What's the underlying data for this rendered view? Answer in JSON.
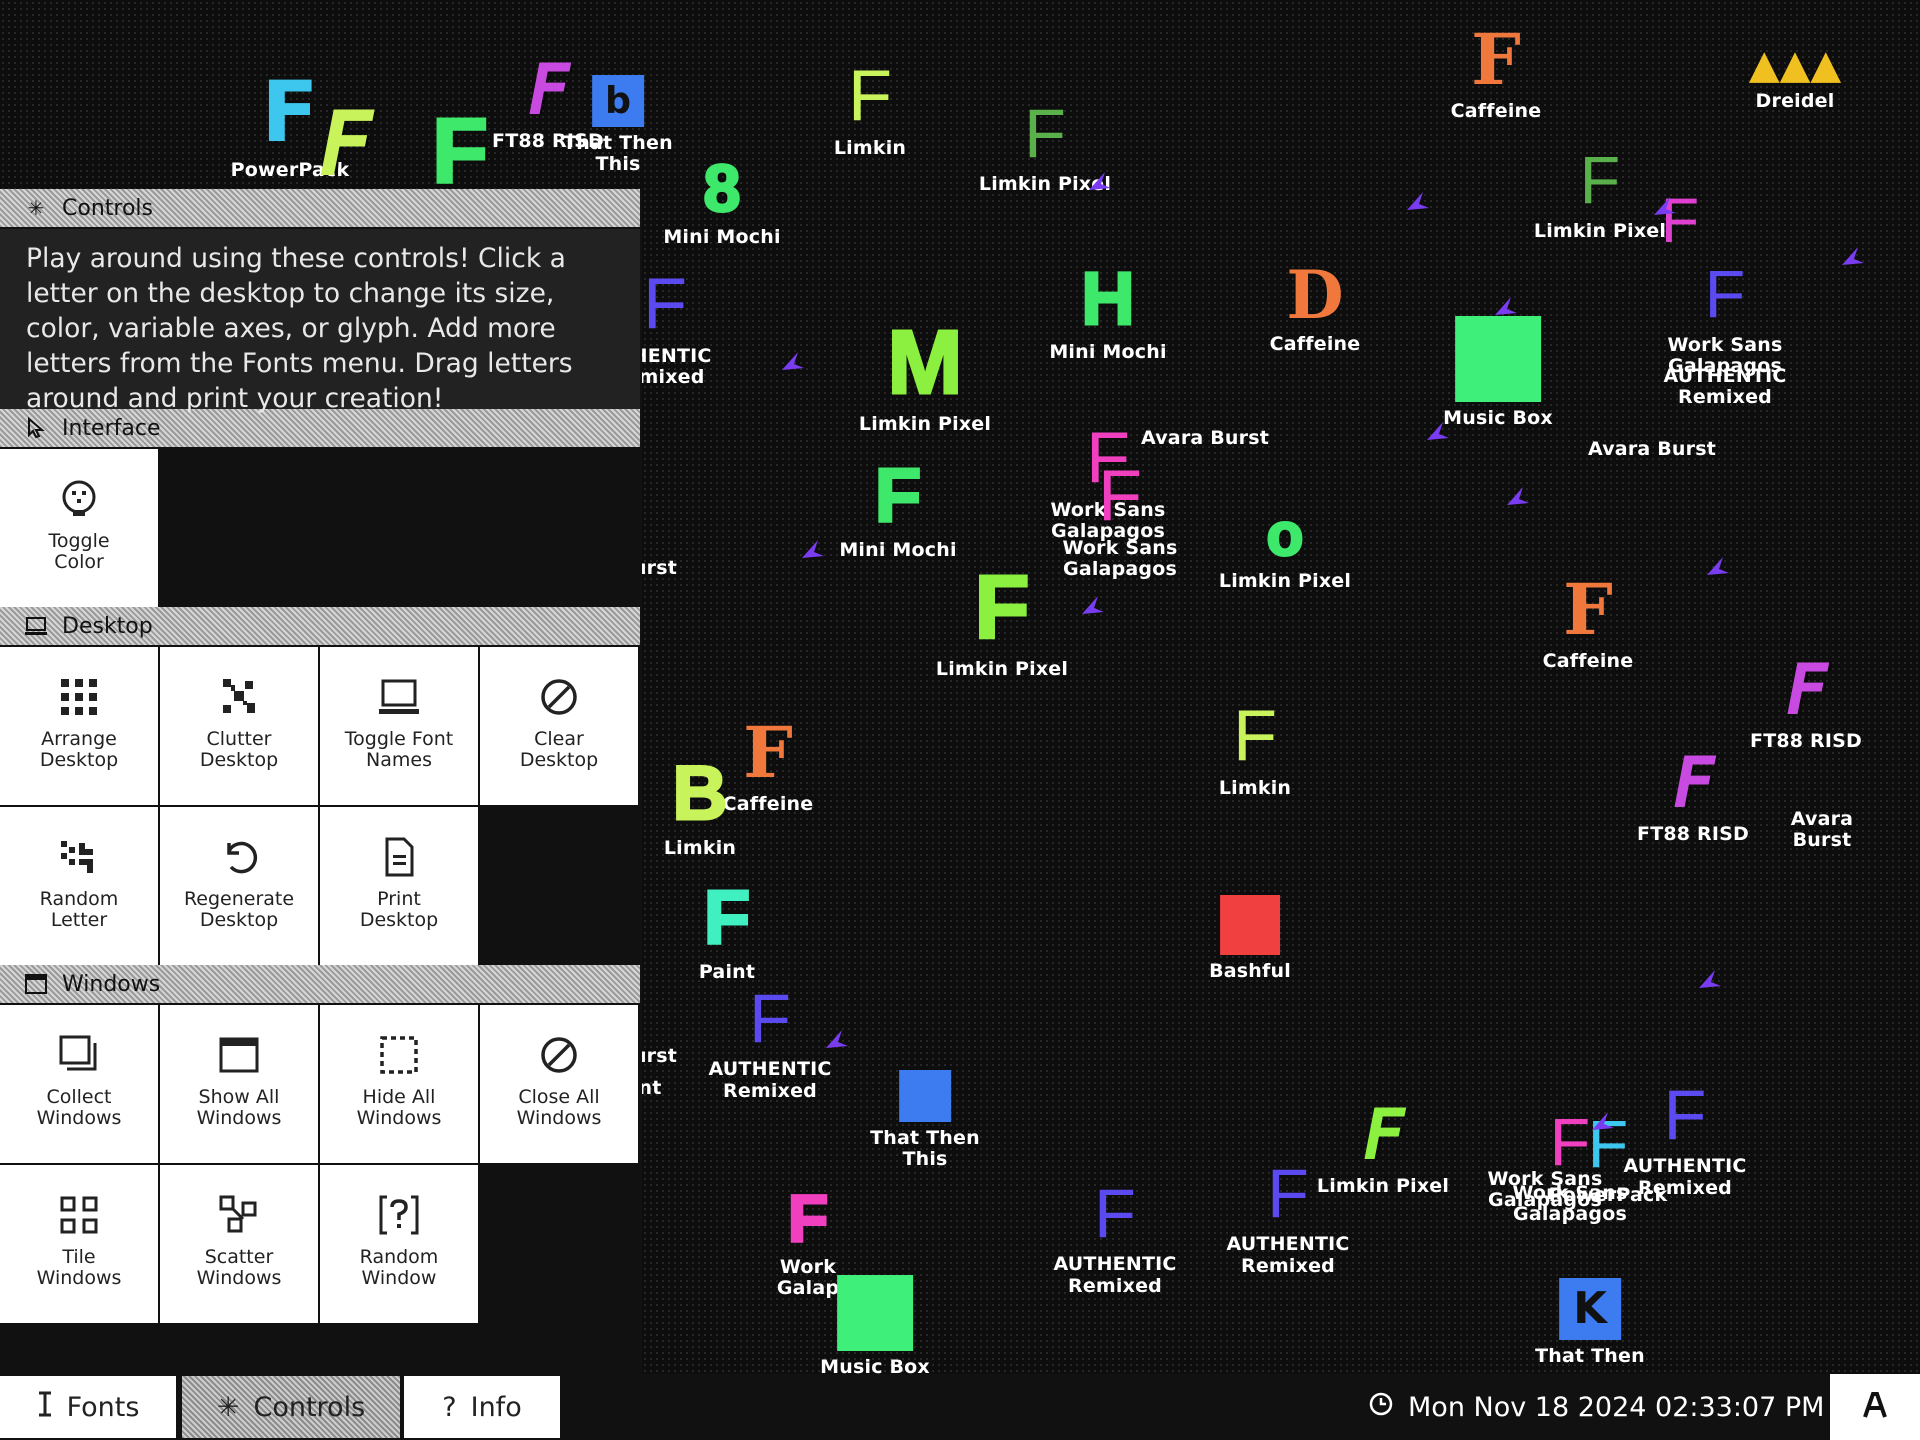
{
  "desktop_items": [
    {
      "glyph": "F",
      "font": "PowerPack",
      "color": "#3ec7ee",
      "label": "PowerPack"
    },
    {
      "glyph": "F",
      "font": "Limkin Pixel",
      "color": "#c8f35a",
      "label": ""
    },
    {
      "glyph": "F",
      "font": "Mini Mochi",
      "color": "#3ee86b",
      "label": ""
    },
    {
      "glyph": "F",
      "font": "FT88 RISD",
      "color": "#c84ae0",
      "label": "FT88 RISD"
    },
    {
      "glyph": "b",
      "font": "That Then This",
      "color": "#3d7bf0",
      "label": "That Then\nThis"
    },
    {
      "glyph": "8",
      "font": "Mini Mochi",
      "color": "#3ee86b",
      "label": "Mini Mochi"
    },
    {
      "glyph": "F",
      "font": "Limkin",
      "color": "#c8f35a",
      "label": "Limkin"
    },
    {
      "glyph": "F",
      "font": "Limkin Pixel",
      "color": "#5ab04a",
      "label": "Limkin Pixel"
    },
    {
      "glyph": "F",
      "font": "Caffeine",
      "color": "#f0783c",
      "label": "Caffeine"
    },
    {
      "glyph": "Dreidel",
      "font": "Dreidel",
      "color": "#f0c020",
      "label": "Dreidel"
    },
    {
      "glyph": "F",
      "font": "Limkin Pixel",
      "color": "#5ab04a",
      "label": "Limkin Pixel"
    },
    {
      "glyph": "F",
      "font": "Work Sans Galapagos",
      "color": "#e040d0",
      "label": ""
    },
    {
      "glyph": "F",
      "font": "AUTHENTIC Remixed",
      "color": "#5a4af0",
      "label": "Work Sans\nGalapagos"
    },
    {
      "glyph": "F",
      "font": "AUTHENTIC Remixed",
      "color": "#5a4af0",
      "label": "THENTIC\nemixed"
    },
    {
      "glyph": "M",
      "font": "Limkin Pixel",
      "color": "#8cf040",
      "label": "Limkin Pixel"
    },
    {
      "glyph": "H",
      "font": "Mini Mochi",
      "color": "#3ee86b",
      "label": "Mini Mochi"
    },
    {
      "glyph": "D",
      "font": "Caffeine",
      "color": "#f0783c",
      "label": "Caffeine"
    },
    {
      "glyph": "",
      "font": "Music Box",
      "color": "#3ef07a",
      "label": "Music Box"
    },
    {
      "glyph": "",
      "font": "AUTHENTIC Remixed",
      "color": "",
      "label": "AUTHENTIC\nRemixed"
    },
    {
      "glyph": "",
      "font": "Avara Burst",
      "color": "",
      "label": "Avara Burst"
    },
    {
      "glyph": "",
      "font": "Avara Burst",
      "color": "",
      "label": "Avara Burst"
    },
    {
      "glyph": "F",
      "font": "Work Sans Galapagos",
      "color": "#f040c0",
      "label": "Work Sans\nGalapagos"
    },
    {
      "glyph": "F",
      "font": "Work Sans Galapagos",
      "color": "#f040c0",
      "label": "Work Sans\nGalapagos"
    },
    {
      "glyph": "F",
      "font": "Mini Mochi",
      "color": "#3ee86b",
      "label": "Mini Mochi"
    },
    {
      "glyph": "o",
      "font": "Limkin Pixel",
      "color": "#3ee86b",
      "label": "Limkin Pixel"
    },
    {
      "glyph": "",
      "font": "Avara Burst",
      "color": "",
      "label": "urst"
    },
    {
      "glyph": "F",
      "font": "Limkin Pixel",
      "color": "#8cf040",
      "label": "Limkin Pixel"
    },
    {
      "glyph": "F",
      "font": "Caffeine",
      "color": "#f0783c",
      "label": "Caffeine"
    },
    {
      "glyph": "F",
      "font": "FT88 RISD",
      "color": "#c84ae0",
      "label": "FT88 RISD"
    },
    {
      "glyph": "",
      "font": "Avara Burst",
      "color": "",
      "label": "Avara Burst"
    },
    {
      "glyph": "F",
      "font": "FT88 RISD",
      "color": "#c84ae0",
      "label": "FT88 RISD"
    },
    {
      "glyph": "F",
      "font": "Caffeine",
      "color": "#f0783c",
      "label": "Caffeine"
    },
    {
      "glyph": "B",
      "font": "Limkin",
      "color": "#c8f35a",
      "label": "Limkin"
    },
    {
      "glyph": "F",
      "font": "Limkin",
      "color": "#c8f35a",
      "label": "Limkin"
    },
    {
      "glyph": "F",
      "font": "Paint",
      "color": "#40f0c0",
      "label": "Paint"
    },
    {
      "glyph": "",
      "font": "Bashful",
      "color": "#f04040",
      "label": "Bashful"
    },
    {
      "glyph": "F",
      "font": "AUTHENTIC Remixed",
      "color": "#5a4af0",
      "label": "AUTHENTIC\nRemixed"
    },
    {
      "glyph": "",
      "font": "Avara Burst",
      "color": "",
      "label": "urst"
    },
    {
      "glyph": "",
      "font": "Paint",
      "color": "",
      "label": "nt"
    },
    {
      "glyph": "",
      "font": "That Then This",
      "color": "#3d7bf0",
      "label": "That Then\nThis"
    },
    {
      "glyph": "F",
      "font": "Limkin Pixel",
      "color": "#8cf040",
      "label": "Limkin Pixel"
    },
    {
      "glyph": "F",
      "font": "Work Sans Galapagos",
      "color": "#f040c0",
      "label": "Work Sans\nGalapagos"
    },
    {
      "glyph": "F",
      "font": "PowerPack",
      "color": "#3ec7ee",
      "label": "PowerPack"
    },
    {
      "glyph": "F",
      "font": "AUTHENTIC Remixed",
      "color": "#5a4af0",
      "label": "AUTHENTIC\nRemixed"
    },
    {
      "glyph": "F",
      "font": "Work Sans Galapagos",
      "color": "#f040c0",
      "label": "Work Sans\nGalapagos"
    },
    {
      "glyph": "F",
      "font": "Work Sans Galapagos",
      "color": "#f040c0",
      "label": "Work\nGalap"
    },
    {
      "glyph": "",
      "font": "Music Box",
      "color": "#3ef07a",
      "label": "Music Box"
    },
    {
      "glyph": "F",
      "font": "AUTHENTIC Remixed",
      "color": "#5a4af0",
      "label": "AUTHENTIC\nRemixed"
    },
    {
      "glyph": "F",
      "font": "AUTHENTIC Remixed",
      "color": "#5a4af0",
      "label": "AUTHENTIC\nRemixed"
    },
    {
      "glyph": "K",
      "font": "That Then This",
      "color": "#3d7bf0",
      "label": "That Then"
    }
  ],
  "controls": {
    "title": "Controls",
    "title_icon": "sparkle-icon",
    "intro": "Play around using these controls! Click a letter on the desktop to change its size, color, variable axes, or glyph. Add more letters from the Fonts menu. Drag letters around and print your creation!",
    "interface": {
      "title": "Interface",
      "icon": "cursor-icon",
      "buttons": [
        {
          "label": "Toggle\nColor",
          "icon": "palette-icon"
        }
      ]
    },
    "desktop": {
      "title": "Desktop",
      "icon": "monitor-icon",
      "buttons": [
        {
          "label": "Arrange\nDesktop",
          "icon": "grid-icon"
        },
        {
          "label": "Clutter\nDesktop",
          "icon": "clutter-icon"
        },
        {
          "label": "Toggle Font\nNames",
          "icon": "laptop-icon"
        },
        {
          "label": "Clear\nDesktop",
          "icon": "prohibit-icon"
        },
        {
          "label": "Random\nLetter",
          "icon": "dice-icon"
        },
        {
          "label": "Regenerate\nDesktop",
          "icon": "refresh-icon"
        },
        {
          "label": "Print\nDesktop",
          "icon": "document-icon"
        }
      ]
    },
    "windows": {
      "title": "Windows",
      "icon": "window-icon",
      "buttons": [
        {
          "label": "Collect\nWindows",
          "icon": "stack-icon"
        },
        {
          "label": "Show All\nWindows",
          "icon": "window-icon"
        },
        {
          "label": "Hide All\nWindows",
          "icon": "dashed-box-icon"
        },
        {
          "label": "Close All\nWindows",
          "icon": "prohibit-icon"
        },
        {
          "label": "Tile\nWindows",
          "icon": "tiles-icon"
        },
        {
          "label": "Scatter\nWindows",
          "icon": "scatter-icon"
        },
        {
          "label": "Random\nWindow",
          "icon": "question-box-icon"
        }
      ]
    }
  },
  "taskbar": {
    "fonts_label": "Fonts",
    "fonts_icon": "text-cursor-icon",
    "controls_label": "Controls",
    "controls_icon": "sparkle-icon",
    "info_label": "Info",
    "info_icon": "question-icon",
    "clock_icon": "clock-icon",
    "datetime": "Mon Nov 18 2024 02:33:07 PM",
    "accessibility_icon": "font-a-icon"
  }
}
